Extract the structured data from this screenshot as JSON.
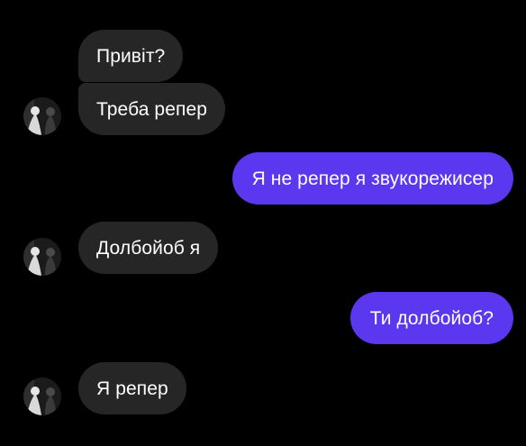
{
  "conversation": {
    "messages": [
      {
        "direction": "incoming",
        "text": "Привіт?"
      },
      {
        "direction": "incoming",
        "text": "Треба репер"
      },
      {
        "direction": "outgoing",
        "text": "Я не репер я звукорежисер"
      },
      {
        "direction": "incoming",
        "text": "Долбойоб я"
      },
      {
        "direction": "outgoing",
        "text": "Ти долбойоб?"
      },
      {
        "direction": "incoming",
        "text": "Я репер"
      }
    ]
  },
  "colors": {
    "background": "#000000",
    "incoming_bubble": "#262626",
    "outgoing_bubble": "#5b38f0",
    "text": "#ffffff"
  },
  "icons": {
    "avatar": "contact-avatar-photo"
  }
}
